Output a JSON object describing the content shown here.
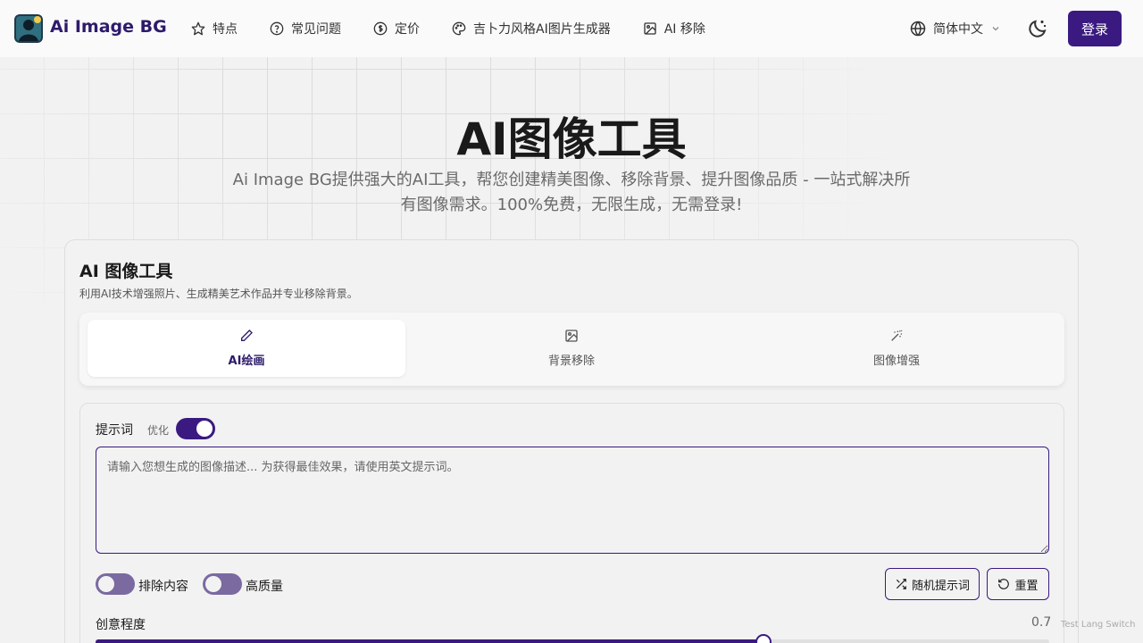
{
  "header": {
    "brand": "Ai Image BG",
    "nav": [
      {
        "label": "特点",
        "icon": "star-icon"
      },
      {
        "label": "常见问题",
        "icon": "help-circle-icon"
      },
      {
        "label": "定价",
        "icon": "dollar-circle-icon"
      },
      {
        "label": "吉卜力风格AI图片生成器",
        "icon": "palette-icon"
      },
      {
        "label": "AI 移除",
        "icon": "image-edit-icon"
      }
    ],
    "language": "简体中文",
    "login": "登录"
  },
  "hero": {
    "title": "AI图像工具",
    "subtitle": "Ai Image BG提供强大的AI工具，帮您创建精美图像、移除背景、提升图像品质 - 一站式解决所有图像需求。100%免费，无限生成，无需登录!"
  },
  "card": {
    "title": "AI 图像工具",
    "description": "利用AI技术增强照片、生成精美艺术作品并专业移除背景。",
    "tabs": [
      {
        "label": "AI绘画",
        "icon": "pencil-icon",
        "active": true
      },
      {
        "label": "背景移除",
        "icon": "image-icon",
        "active": false
      },
      {
        "label": "图像增强",
        "icon": "magic-wand-icon",
        "active": false
      }
    ]
  },
  "form": {
    "prompt_label": "提示词",
    "optimize_label": "优化",
    "optimize_on": true,
    "prompt_placeholder": "请输入您想生成的图像描述... 为获得最佳效果，请使用英文提示词。",
    "exclude_label": "排除内容",
    "exclude_on": false,
    "quality_label": "高质量",
    "quality_on": false,
    "random_button": "随机提示词",
    "reset_button": "重置",
    "creativity_label": "创意程度",
    "creativity_value": "0.7",
    "creativity_fraction": 0.7
  },
  "footer": {
    "test_lang": "Test Lang Switch"
  },
  "colors": {
    "accent": "#3a1a80",
    "brand_text": "#2e1a6b"
  }
}
